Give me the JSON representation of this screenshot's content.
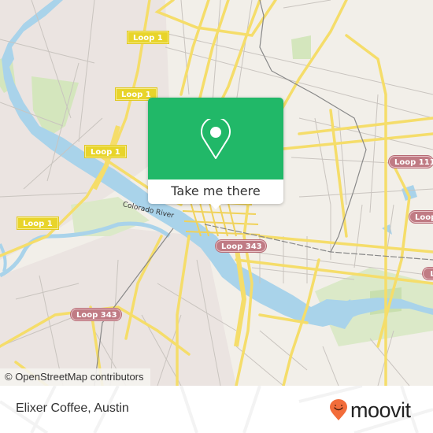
{
  "map": {
    "attribution": "© OpenStreetMap contributors",
    "river_label": "Colorado River",
    "shields": [
      {
        "label": "Loop 1",
        "style": "yellow"
      },
      {
        "label": "Loop 1",
        "style": "yellow"
      },
      {
        "label": "Loop 1",
        "style": "yellow"
      },
      {
        "label": "Loop 1",
        "style": "yellow"
      },
      {
        "label": "Loop 343",
        "style": "red"
      },
      {
        "label": "Loop 343",
        "style": "red"
      },
      {
        "label": "Loop 111",
        "style": "red"
      },
      {
        "label": "Loop",
        "style": "red"
      },
      {
        "label": "L",
        "style": "red"
      }
    ],
    "colors": {
      "land": "#f2efe9",
      "residential": "#e9e2df",
      "water": "#a9d3ea",
      "park": "#d6e8c0",
      "road": "#f5dd6a",
      "minor_road": "#c8c3be",
      "shield_yellow": "#e8d42a",
      "shield_red": "#c07b84"
    }
  },
  "popup": {
    "icon": "map-pin-icon",
    "button_label": "Take me there",
    "header_color": "#21b868"
  },
  "footer": {
    "place_name": "Elixer Coffee, Austin",
    "brand": "moovit",
    "brand_color": "#f26c3a"
  }
}
